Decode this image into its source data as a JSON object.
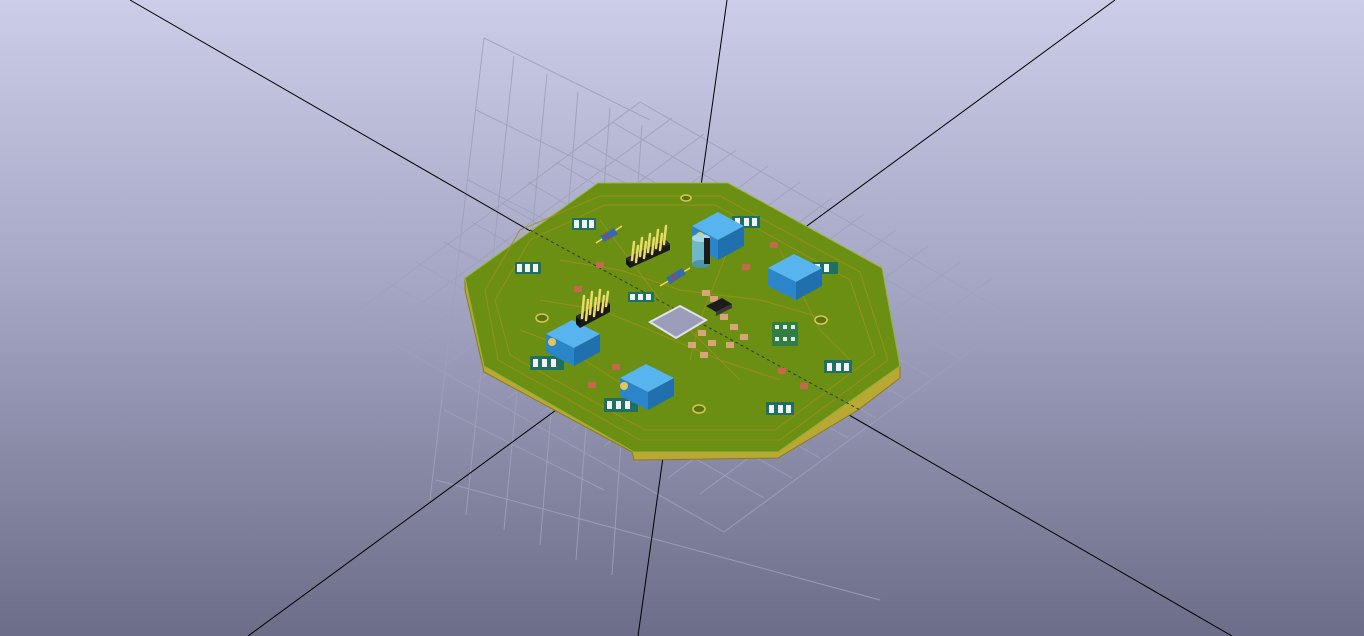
{
  "viewer": {
    "view": "3D board view",
    "background_top": "#cccde8",
    "background_bottom": "#6c6d88"
  },
  "board": {
    "shape": "octagon",
    "soldermask_color": "#6b8f12",
    "edge_color": "#c8b43a",
    "copper_trace_color": "#a08f1e",
    "center_cutout": true,
    "mounting_holes": 4
  },
  "components": {
    "trimmer_potentiometers": {
      "count": 4,
      "color": "#2f93d8"
    },
    "pin_headers": {
      "count": 2,
      "rows": 2,
      "color": "#e9da6a"
    },
    "electrolytic_capacitor": {
      "count": 1,
      "color": "#6fb8c8"
    },
    "axial_resistors": {
      "count": 2,
      "color": "#3a68b0"
    },
    "smd_ic": {
      "count": 1,
      "color": "#1c1c1c"
    },
    "smd_pad_groups": {
      "count": 10
    }
  },
  "axes": {
    "color": "#000000"
  },
  "grid": {
    "color": "#9fa1bb"
  }
}
